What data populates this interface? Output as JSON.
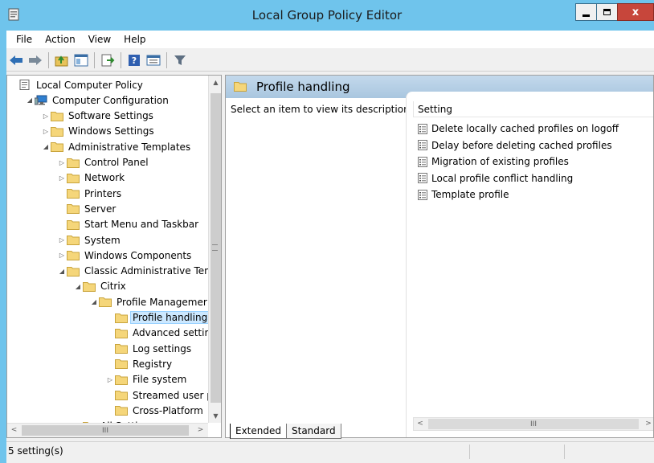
{
  "window": {
    "title": "Local Group Policy Editor",
    "close_glyph": "x"
  },
  "menu": [
    "File",
    "Action",
    "View",
    "Help"
  ],
  "toolbar": {
    "icons": [
      "back-arrow-icon",
      "forward-arrow-icon",
      "up-folder-icon",
      "show-hide-tree-icon",
      "export-list-icon",
      "help-icon",
      "properties-icon",
      "filter-icon"
    ]
  },
  "tree": {
    "items": [
      {
        "label": "Local Computer Policy",
        "level": 0,
        "expander": "",
        "icon": "policy-icon"
      },
      {
        "label": "Computer Configuration",
        "level": 1,
        "expander": "◢",
        "icon": "computer-icon"
      },
      {
        "label": "Software Settings",
        "level": 2,
        "expander": "▷",
        "icon": "folder-icon"
      },
      {
        "label": "Windows Settings",
        "level": 2,
        "expander": "▷",
        "icon": "folder-icon"
      },
      {
        "label": "Administrative Templates",
        "level": 2,
        "expander": "◢",
        "icon": "folder-icon"
      },
      {
        "label": "Control Panel",
        "level": 3,
        "expander": "▷",
        "icon": "folder-icon"
      },
      {
        "label": "Network",
        "level": 3,
        "expander": "▷",
        "icon": "folder-icon"
      },
      {
        "label": "Printers",
        "level": 3,
        "expander": "",
        "icon": "folder-icon"
      },
      {
        "label": "Server",
        "level": 3,
        "expander": "",
        "icon": "folder-icon"
      },
      {
        "label": "Start Menu and Taskbar",
        "level": 3,
        "expander": "",
        "icon": "folder-icon"
      },
      {
        "label": "System",
        "level": 3,
        "expander": "▷",
        "icon": "folder-icon"
      },
      {
        "label": "Windows Components",
        "level": 3,
        "expander": "▷",
        "icon": "folder-icon"
      },
      {
        "label": "Classic Administrative Tem",
        "level": 3,
        "expander": "◢",
        "icon": "folder-icon"
      },
      {
        "label": "Citrix",
        "level": 4,
        "expander": "◢",
        "icon": "folder-icon"
      },
      {
        "label": "Profile Managemer",
        "level": 5,
        "expander": "◢",
        "icon": "folder-icon"
      },
      {
        "label": "Profile handling",
        "level": 6,
        "expander": "",
        "icon": "folder-icon",
        "selected": true
      },
      {
        "label": "Advanced settir",
        "level": 6,
        "expander": "",
        "icon": "folder-icon"
      },
      {
        "label": "Log settings",
        "level": 6,
        "expander": "",
        "icon": "folder-icon"
      },
      {
        "label": "Registry",
        "level": 6,
        "expander": "",
        "icon": "folder-icon"
      },
      {
        "label": "File system",
        "level": 6,
        "expander": "▷",
        "icon": "folder-icon"
      },
      {
        "label": "Streamed user p",
        "level": 6,
        "expander": "",
        "icon": "folder-icon"
      },
      {
        "label": "Cross-Platform",
        "level": 6,
        "expander": "",
        "icon": "folder-icon"
      },
      {
        "label": "All Settings",
        "level": 4,
        "expander": "",
        "icon": "folder-icon"
      }
    ],
    "scroll_glyphs": {
      "up": "▲",
      "down": "▼",
      "left": "<",
      "right": ">",
      "thumb": "III",
      "grip": "≡"
    }
  },
  "right": {
    "header": "Profile handling",
    "description": "Select an item to view its description.",
    "column_header": "Setting",
    "settings": [
      "Delete locally cached profiles on logoff",
      "Delay before deleting cached profiles",
      "Migration of existing profiles",
      "Local profile conflict handling",
      "Template profile"
    ],
    "scroll_glyphs": {
      "left": "<",
      "right": ">",
      "thumb": "III"
    }
  },
  "tabs": [
    "Extended",
    "Standard"
  ],
  "status": {
    "text": "5 setting(s)"
  }
}
